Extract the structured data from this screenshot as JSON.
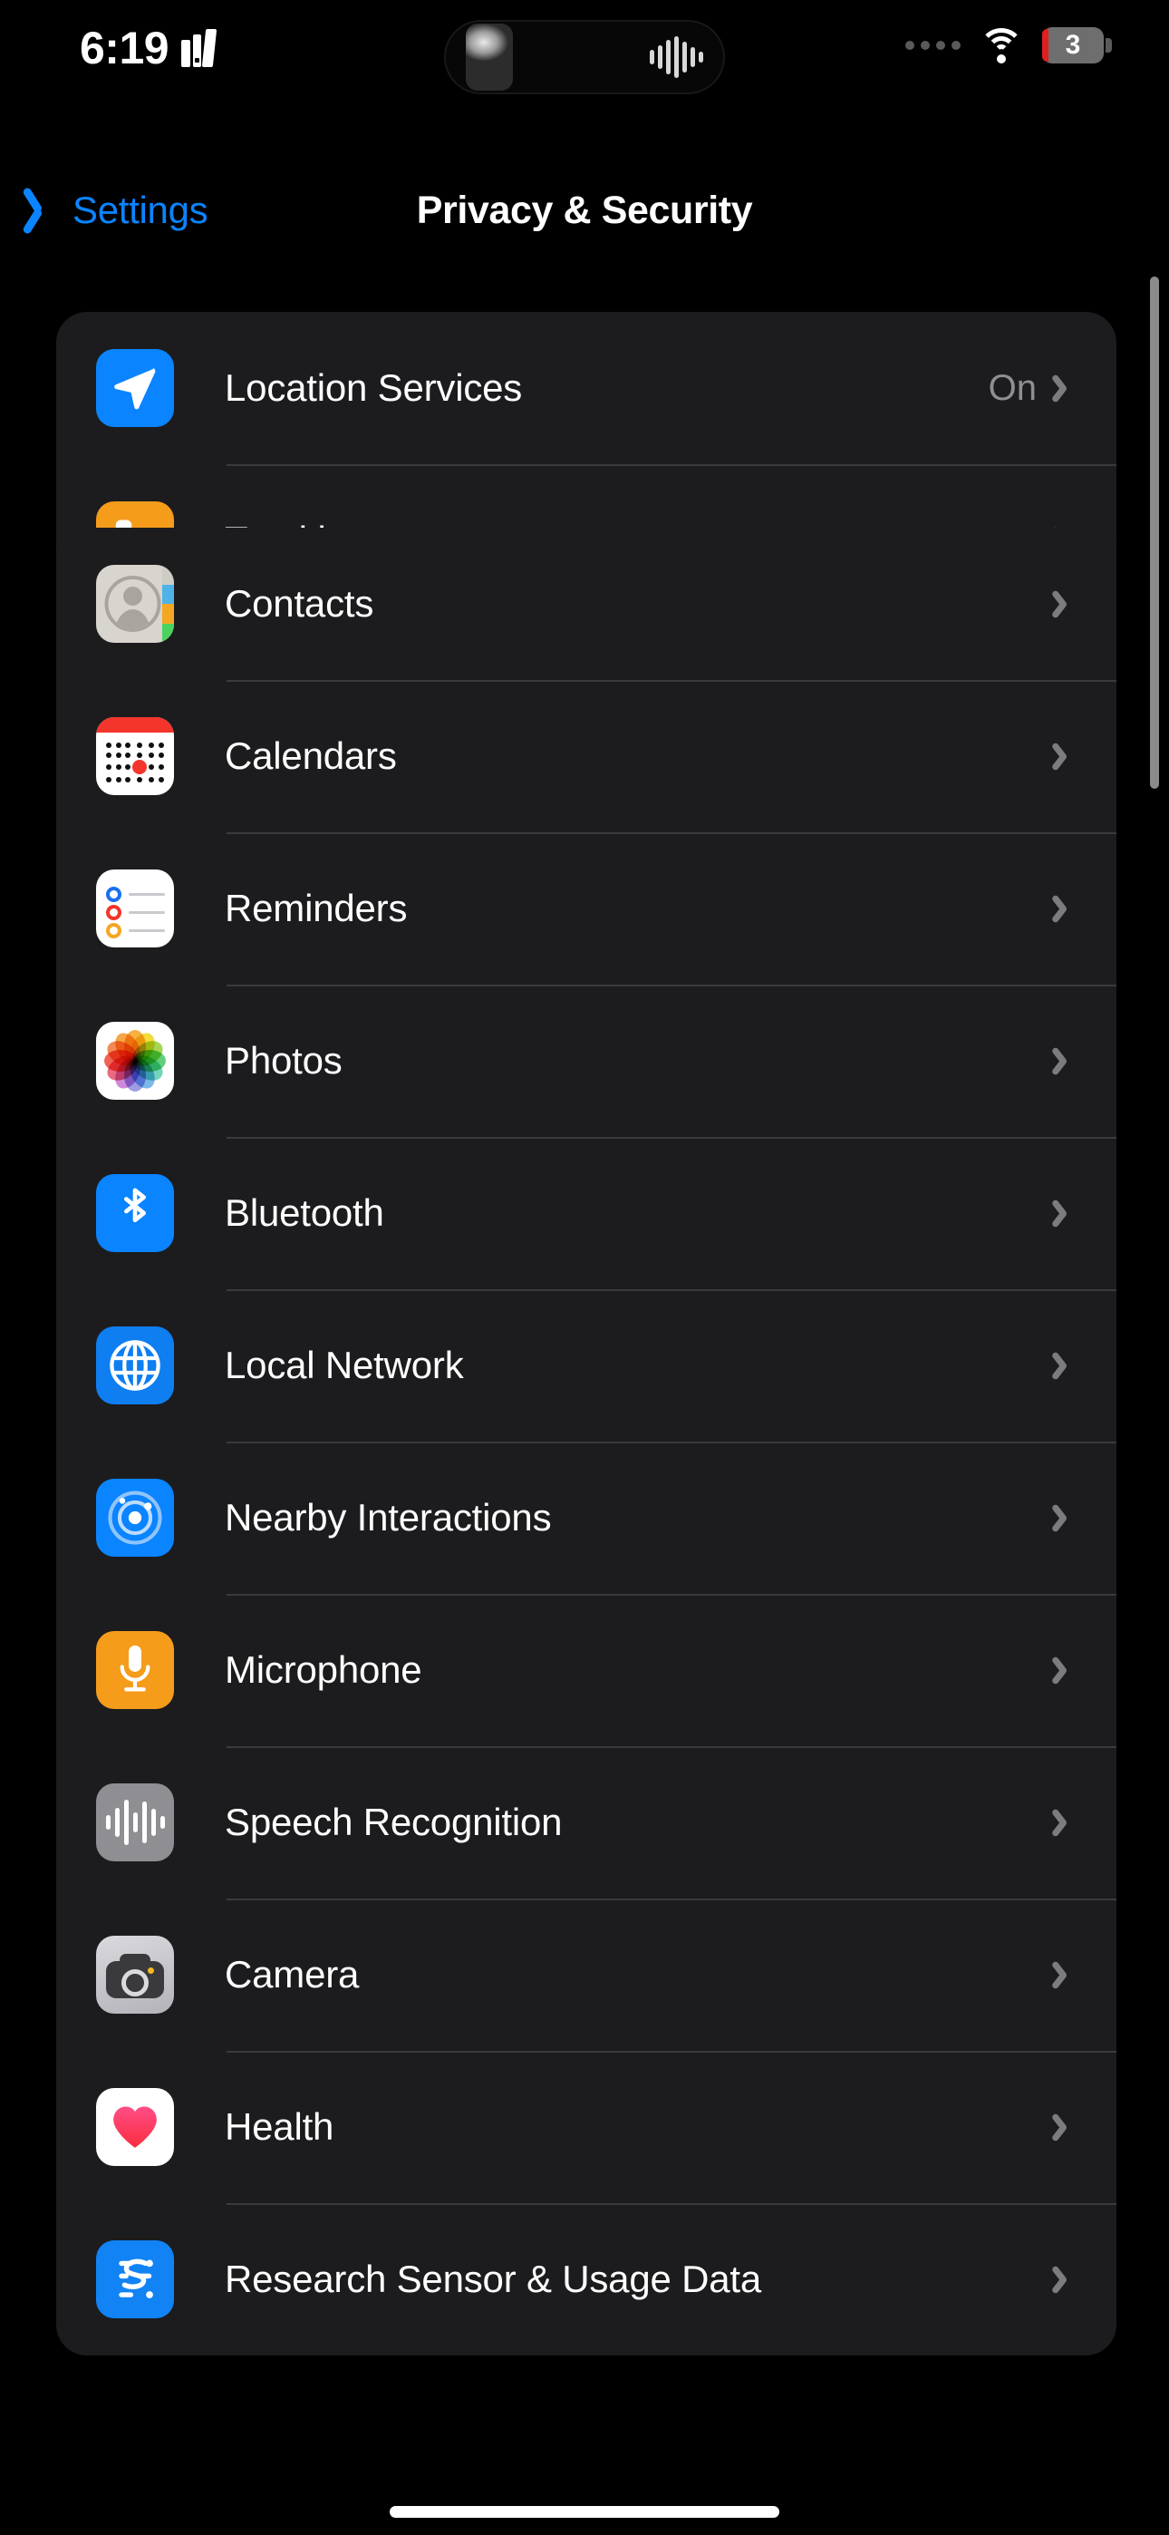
{
  "status_bar": {
    "time": "6:19",
    "books_icon": "books-icon",
    "dynamic_island": {
      "thumbnail": "media-thumbnail",
      "waveform_icon": "audio-waveform-icon"
    },
    "signal_dots_icon": "cellular-dots-icon",
    "wifi_icon": "wifi-icon",
    "battery_level": "3"
  },
  "nav": {
    "back_label": "Settings",
    "back_icon": "chevron-left-icon",
    "title": "Privacy & Security"
  },
  "groups": [
    {
      "id": "primary",
      "rows": [
        {
          "label": "Location Services",
          "value": "On",
          "icon": "location-arrow-icon"
        },
        {
          "label": "Tracking",
          "value": "",
          "icon": "tracking-nodes-icon"
        }
      ]
    },
    {
      "id": "apps",
      "rows": [
        {
          "label": "Contacts",
          "value": "",
          "icon": "contacts-icon"
        },
        {
          "label": "Calendars",
          "value": "",
          "icon": "calendar-icon"
        },
        {
          "label": "Reminders",
          "value": "",
          "icon": "reminders-icon"
        },
        {
          "label": "Photos",
          "value": "",
          "icon": "photos-icon"
        },
        {
          "label": "Bluetooth",
          "value": "",
          "icon": "bluetooth-icon"
        },
        {
          "label": "Local Network",
          "value": "",
          "icon": "globe-icon"
        },
        {
          "label": "Nearby Interactions",
          "value": "",
          "icon": "nearby-interactions-icon"
        },
        {
          "label": "Microphone",
          "value": "",
          "icon": "microphone-icon"
        },
        {
          "label": "Speech Recognition",
          "value": "",
          "icon": "speech-waveform-icon"
        },
        {
          "label": "Camera",
          "value": "",
          "icon": "camera-icon"
        },
        {
          "label": "Health",
          "value": "",
          "icon": "heart-icon"
        },
        {
          "label": "Research Sensor & Usage Data",
          "value": "",
          "icon": "research-sensor-icon"
        }
      ]
    }
  ],
  "colors": {
    "accent_blue": "#0a84ff",
    "card_background": "#1c1c1e",
    "page_background": "#000000",
    "separator": "#3a3a3c",
    "secondary_text": "#8e8e93",
    "orange": "#f59c1b",
    "red": "#f3352b",
    "gray": "#8e8e93"
  },
  "scrollbar": {
    "name": "vertical-scrollbar"
  },
  "home_indicator": {
    "name": "home-indicator"
  }
}
